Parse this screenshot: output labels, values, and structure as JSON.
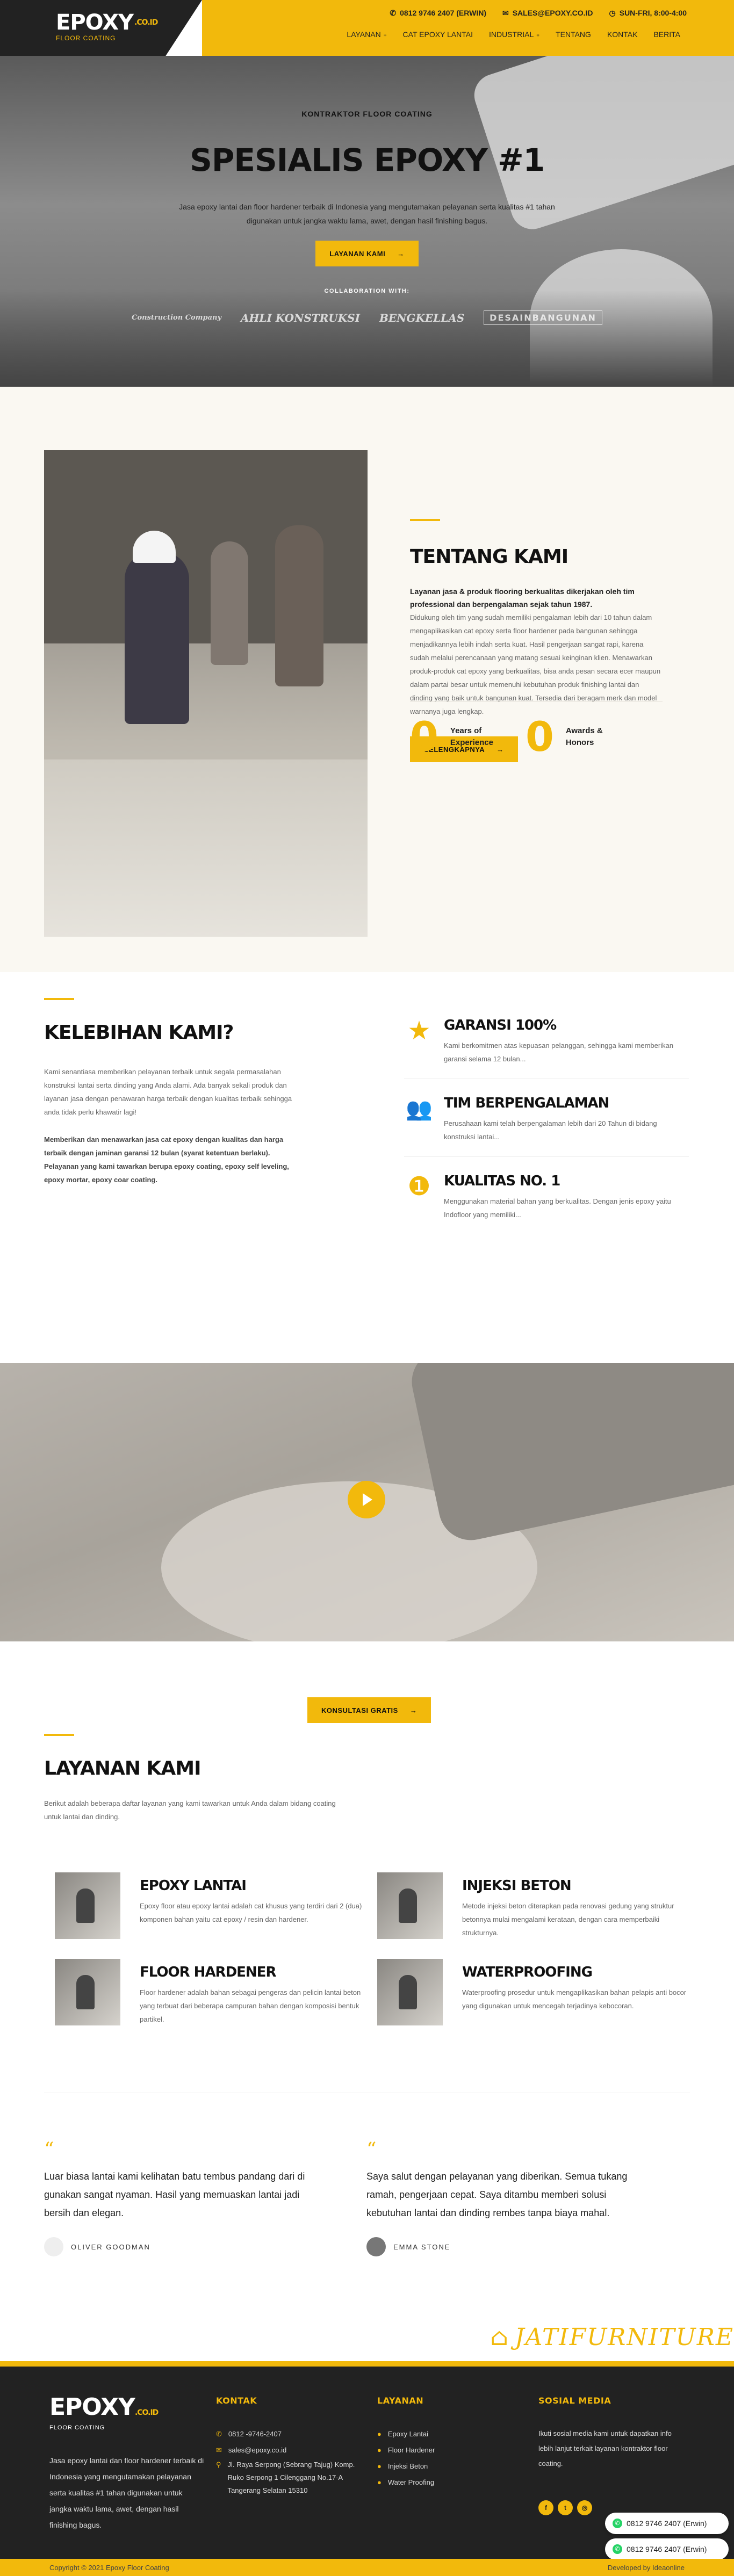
{
  "brand": {
    "name": "EPOXY",
    "tld": ".CO.ID",
    "sub": "FLOOR COATING"
  },
  "topbar": {
    "phone": "0812 9746 2407 (ERWIN)",
    "email": "SALES@EPOXY.CO.ID",
    "hours": "SUN-FRI, 8:00-4:00"
  },
  "nav": [
    "LAYANAN",
    "CAT EPOXY LANTAI",
    "INDUSTRIAL",
    "TENTANG",
    "KONTAK",
    "BERITA"
  ],
  "hero": {
    "eyebrow": "KONTRAKTOR FLOOR COATING",
    "title": "SPESIALIS EPOXY #1",
    "desc": "Jasa epoxy lantai dan floor hardener terbaik di Indonesia yang mengutamakan pelayanan serta kualitas #1 tahan digunakan untuk jangka waktu lama, awet, dengan hasil finishing bagus.",
    "button": "LAYANAN KAMI",
    "collab": "COLLABORATION WITH:",
    "partners": [
      "Construction Company",
      "AHLI KONSTRUKSI",
      "BENGKELLAS",
      "DESAINBANGUNAN"
    ]
  },
  "about": {
    "title": "TENTANG KAMI",
    "lead": "Layanan jasa & produk flooring berkualitas dikerjakan oleh tim professional dan berpengalaman sejak tahun 1987.",
    "body": "Didukung oleh tim yang sudah memiliki pengalaman lebih dari 10 tahun dalam mengaplikasikan cat epoxy serta floor hardener pada bangunan sehingga menjadikannya lebih indah serta kuat. Hasil pengerjaan sangat rapi, karena sudah melalui perencanaan yang matang sesuai keinginan klien. Menawarkan produk-produk cat epoxy yang berkualitas, bisa anda pesan secara ecer maupun dalam partai besar untuk memenuhi kebutuhan produk finishing lantai dan dinding yang baik untuk bangunan kuat. Tersedia dari beragam merk dan model warnanya juga lengkap.",
    "button": "SELENGKAPNYA",
    "stats": [
      {
        "num": "0",
        "label1": "Years of",
        "label2": "Experience"
      },
      {
        "num": "0",
        "label1": "Awards &",
        "label2": "Honors"
      }
    ]
  },
  "advantages": {
    "title": "KELEBIHAN KAMI?",
    "p1": "Kami senantiasa memberikan pelayanan terbaik untuk segala permasalahan konstruksi lantai serta dinding yang Anda alami. Ada banyak sekali produk dan layanan jasa dengan penawaran harga terbaik dengan kualitas terbaik sehingga anda tidak perlu khawatir lagi!",
    "p2": "Memberikan dan menawarkan jasa cat epoxy dengan kualitas dan harga terbaik dengan jaminan garansi 12 bulan (syarat ketentuan berlaku). Pelayanan yang kami tawarkan berupa epoxy coating, epoxy self leveling, epoxy mortar, epoxy coar coating.",
    "features": [
      {
        "icon": "★",
        "title": "GARANSI 100%",
        "text": "Kami berkomitmen atas kepuasan pelanggan, sehingga kami memberikan garansi selama 12 bulan..."
      },
      {
        "icon": "👥",
        "title": "TIM BERPENGALAMAN",
        "text": "Perusahaan kami telah berpengalaman lebih dari 20 Tahun di bidang konstruksi lantai..."
      },
      {
        "icon": "❶",
        "title": "KUALITAS NO. 1",
        "text": "Menggunakan material bahan yang berkualitas. Dengan jenis epoxy yaitu Indofloor yang memiliki..."
      }
    ]
  },
  "services": {
    "consult": "KONSULTASI GRATIS",
    "title": "LAYANAN KAMI",
    "desc": "Berikut adalah beberapa daftar layanan yang kami tawarkan untuk Anda dalam bidang coating untuk lantai dan dinding.",
    "items": [
      {
        "title": "EPOXY LANTAI",
        "text": "Epoxy floor atau epoxy lantai adalah cat khusus yang terdiri dari 2 (dua) komponen bahan yaitu cat epoxy / resin dan hardener."
      },
      {
        "title": "INJEKSI BETON",
        "text": "Metode injeksi beton diterapkan pada renovasi gedung yang struktur betonnya mulai mengalami kerataan, dengan cara memperbaiki strukturnya."
      },
      {
        "title": "FLOOR HARDENER",
        "text": "Floor hardener adalah bahan sebagai pengeras dan pelicin lantai beton yang terbuat dari beberapa campuran bahan dengan komposisi bentuk partikel."
      },
      {
        "title": "WATERPROOFING",
        "text": "Waterproofing prosedur untuk mengaplikasikan bahan pelapis anti bocor yang digunakan untuk mencegah terjadinya kebocoran."
      }
    ]
  },
  "testimonials": [
    {
      "text": "Luar biasa lantai kami kelihatan batu tembus pandang dari di gunakan sangat nyaman. Hasil yang memuaskan lantai jadi bersih dan elegan.",
      "author": "OLIVER GOODMAN"
    },
    {
      "text": "Saya salut dengan pelayanan yang diberikan. Semua tukang ramah, pengerjaan cepat. Saya ditambu memberi solusi kebutuhan lantai dan dinding rembes tanpa biaya mahal.",
      "author": "EMMA STONE"
    }
  ],
  "partner": "JATIFURNITURE",
  "footer": {
    "desc": "Jasa epoxy lantai dan floor hardener terbaik di Indonesia yang mengutamakan pelayanan serta kualitas #1 tahan digunakan untuk jangka waktu lama, awet, dengan hasil finishing bagus.",
    "kontak_title": "KONTAK",
    "kontak": [
      "0812 -9746-2407",
      "sales@epoxy.co.id",
      "Jl. Raya Serpong (Sebrang Tajug) Komp. Ruko Serpong 1 Cilenggang No.17-A Tangerang Selatan 15310"
    ],
    "layanan_title": "LAYANAN",
    "layanan": [
      "Epoxy Lantai",
      "Floor Hardener",
      "Injeksi Beton",
      "Water Proofing"
    ],
    "sosial_title": "SOSIAL MEDIA",
    "sosial_text": "Ikuti sosial media kami untuk dapatkan info lebih lanjut terkait layanan kontraktor floor coating.",
    "copyright": "Copyright © 2021 Epoxy Floor Coating",
    "dev": "Developed by Ideaonline",
    "wa": [
      "0812 9746 2407 (Erwin)",
      "0812 9746 2407 (Erwin)"
    ]
  }
}
